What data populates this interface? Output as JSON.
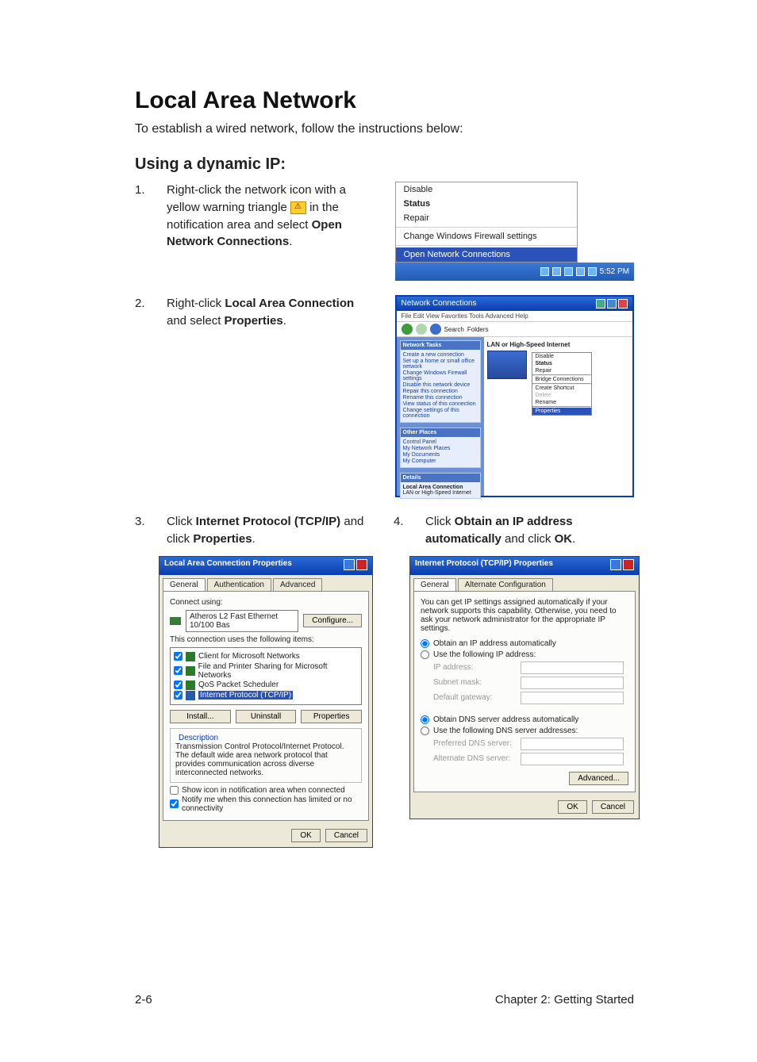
{
  "heading": "Local Area Network",
  "intro": "To establish a wired network, follow the instructions below:",
  "subheading": "Using a dynamic IP:",
  "steps": {
    "s1": {
      "n": "1.",
      "a": "Right-click the network icon with a yellow warning triangle ",
      "b": " in the notification area and select ",
      "c": "Open Network Connections",
      "d": "."
    },
    "s2": {
      "n": "2.",
      "a": "Right-click ",
      "b": "Local Area Connection",
      "c": " and select ",
      "d": "Properties",
      "e": "."
    },
    "s3": {
      "n": "3.",
      "a": "Click ",
      "b": "Internet Protocol (TCP/IP)",
      "c": " and click ",
      "d": "Properties",
      "e": "."
    },
    "s4": {
      "n": "4.",
      "a": "Click ",
      "b": "Obtain an IP address automatically",
      "c": " and click ",
      "d": "OK",
      "e": "."
    }
  },
  "ctxmenu": {
    "disable": "Disable",
    "status": "Status",
    "repair": "Repair",
    "firewall": "Change Windows Firewall settings",
    "open": "Open Network Connections",
    "time": "5:52 PM"
  },
  "netwin": {
    "title": "Network Connections",
    "menu": "File   Edit   View   Favorites   Tools   Advanced   Help",
    "search": "Search",
    "folders": "Folders",
    "cat": "LAN or High-Speed Internet",
    "conn_label": "Local Area Connection",
    "side1_hdr": "Network Tasks",
    "side1": [
      "Create a new connection",
      "Set up a home or small office network",
      "Change Windows Firewall settings",
      "Disable this network device",
      "Repair this connection",
      "Rename this connection",
      "View status of this connection",
      "Change settings of this connection"
    ],
    "side2_hdr": "Other Places",
    "side2": [
      "Control Panel",
      "My Network Places",
      "My Documents",
      "My Computer"
    ],
    "side3_hdr": "Details",
    "side3a": "Local Area Connection",
    "side3b": "LAN or High-Speed Internet",
    "mini": {
      "disable": "Disable",
      "status": "Status",
      "repair": "Repair",
      "bridge": "Bridge Connections",
      "shortcut": "Create Shortcut",
      "delete": "Delete",
      "rename": "Rename",
      "props": "Properties"
    }
  },
  "lac": {
    "title": "Local Area Connection Properties",
    "tabs": [
      "General",
      "Authentication",
      "Advanced"
    ],
    "connect_using": "Connect using:",
    "adapter": "Atheros L2 Fast Ethernet 10/100 Bas",
    "configure": "Configure...",
    "uses": "This connection uses the following items:",
    "items": [
      "Client for Microsoft Networks",
      "File and Printer Sharing for Microsoft Networks",
      "QoS Packet Scheduler",
      "Internet Protocol (TCP/IP)"
    ],
    "install": "Install...",
    "uninstall": "Uninstall",
    "properties": "Properties",
    "desc_hdr": "Description",
    "desc": "Transmission Control Protocol/Internet Protocol. The default wide area network protocol that provides communication across diverse interconnected networks.",
    "show_icon": "Show icon in notification area when connected",
    "notify": "Notify me when this connection has limited or no connectivity",
    "ok": "OK",
    "cancel": "Cancel"
  },
  "tcp": {
    "title": "Internet Protocol (TCP/IP) Properties",
    "tabs": [
      "General",
      "Alternate Configuration"
    ],
    "blurb": "You can get IP settings assigned automatically if your network supports this capability. Otherwise, you need to ask your network administrator for the appropriate IP settings.",
    "r1": "Obtain an IP address automatically",
    "r2": "Use the following IP address:",
    "ip": "IP address:",
    "subnet": "Subnet mask:",
    "gateway": "Default gateway:",
    "r3": "Obtain DNS server address automatically",
    "r4": "Use the following DNS server addresses:",
    "pdns": "Preferred DNS server:",
    "adns": "Alternate DNS server:",
    "advanced": "Advanced...",
    "ok": "OK",
    "cancel": "Cancel"
  },
  "footer": {
    "left": "2-6",
    "right": "Chapter 2: Getting Started"
  }
}
